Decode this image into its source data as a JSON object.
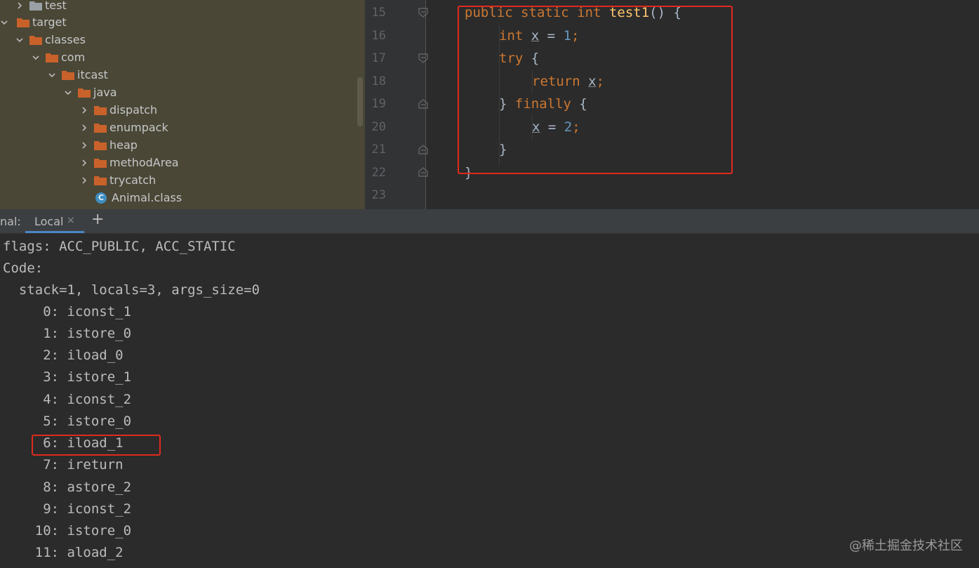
{
  "tree": {
    "items": [
      {
        "label": "test",
        "kind": "folder-gray",
        "expanded": false
      },
      {
        "label": "target",
        "kind": "folder",
        "expanded": true
      },
      {
        "label": "classes",
        "kind": "folder",
        "expanded": true
      },
      {
        "label": "com",
        "kind": "folder",
        "expanded": true
      },
      {
        "label": "itcast",
        "kind": "folder",
        "expanded": true
      },
      {
        "label": "java",
        "kind": "folder",
        "expanded": true
      },
      {
        "label": "dispatch",
        "kind": "folder",
        "expanded": false
      },
      {
        "label": "enumpack",
        "kind": "folder",
        "expanded": false
      },
      {
        "label": "heap",
        "kind": "folder",
        "expanded": false
      },
      {
        "label": "methodArea",
        "kind": "folder",
        "expanded": false
      },
      {
        "label": "trycatch",
        "kind": "folder",
        "expanded": false
      },
      {
        "label": "Animal.class",
        "kind": "class-file",
        "icon_letter": "C"
      }
    ]
  },
  "editor": {
    "line_numbers": [
      "15",
      "16",
      "17",
      "18",
      "19",
      "20",
      "21",
      "22",
      "23"
    ],
    "code": {
      "l15": {
        "kw1": "public",
        "kw2": "static",
        "kw3": "int",
        "fn": "test1",
        "rest": "() {"
      },
      "l16": {
        "kw": "int",
        "var": "x",
        "op": " = ",
        "num": "1",
        "end": ";"
      },
      "l17": {
        "kw": "try",
        "rest": " {"
      },
      "l18": {
        "kw": "return",
        "var": "x",
        "end": ";"
      },
      "l19": {
        "open": "} ",
        "kw": "finally",
        "rest": " {"
      },
      "l20": {
        "var": "x",
        "op": " = ",
        "num": "2",
        "end": ";"
      },
      "l21": {
        "text": "}"
      },
      "l22": {
        "text": "}"
      }
    }
  },
  "terminal": {
    "title": "nal:",
    "tab_label": "Local",
    "close_glyph": "×",
    "add_glyph": "+",
    "lines": [
      "flags: ACC_PUBLIC, ACC_STATIC",
      "Code:",
      "  stack=1, locals=3, args_size=0",
      "     0: iconst_1",
      "     1: istore_0",
      "     2: iload_0",
      "     3: istore_1",
      "     4: iconst_2",
      "     5: istore_0",
      "     6: iload_1",
      "     7: ireturn",
      "     8: astore_2",
      "     9: iconst_2",
      "    10: istore_0",
      "    11: aload_2"
    ]
  },
  "watermark": "@稀土掘金技术社区",
  "colors": {
    "tree_bg": "#4a4736",
    "editor_bg": "#2b2b2b",
    "keyword": "#cc7832",
    "function": "#ffc66d",
    "number": "#6897bb",
    "highlight_box": "#e02a1e"
  }
}
